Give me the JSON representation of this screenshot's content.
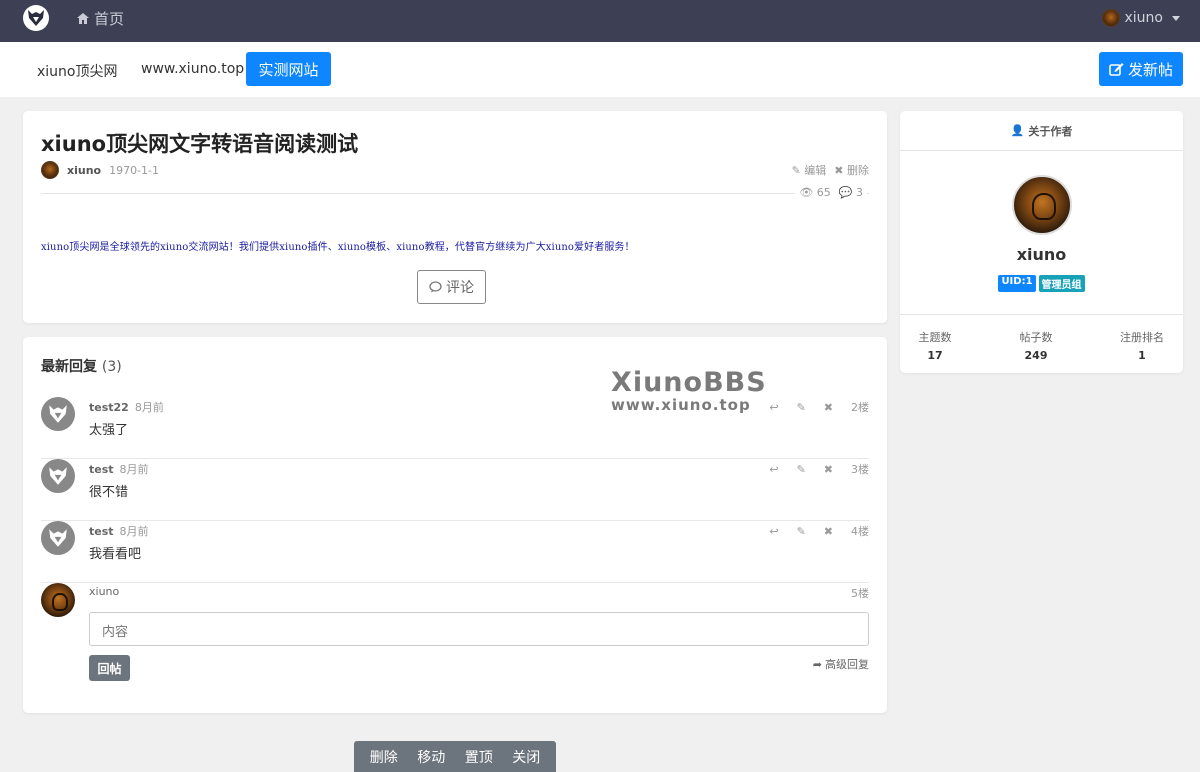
{
  "topbar": {
    "home_label": "首页",
    "user_name": "xiuno"
  },
  "subnav": {
    "links": [
      "xiuno顶尖网",
      "www.xiuno.top"
    ],
    "active_label": "实测网站",
    "new_post_label": "发新帖"
  },
  "post": {
    "title": "xiuno顶尖网文字转语音阅读测试",
    "author": "xiuno",
    "date": "1970-1-1",
    "edit_label": "编辑",
    "delete_label": "删除",
    "views": "65",
    "comments": "3",
    "body": "xiuno顶尖网是全球领先的xiuno交流网站！我们提供xiuno插件、xiuno模板、xiuno教程，代替官方继续为广大xiuno爱好者服务！",
    "comment_button": "评论"
  },
  "replies": {
    "heading": "最新回复",
    "count": "(3)",
    "items": [
      {
        "user": "test22",
        "time": "8月前",
        "text": "太强了",
        "floor": "2楼"
      },
      {
        "user": "test",
        "time": "8月前",
        "text": "很不错",
        "floor": "3楼"
      },
      {
        "user": "test",
        "time": "8月前",
        "text": "我看看吧",
        "floor": "4楼"
      }
    ],
    "composer": {
      "user": "xiuno",
      "floor": "5楼",
      "placeholder": "内容",
      "submit_label": "回帖",
      "advanced_label": "高级回复"
    }
  },
  "watermark": {
    "line1": "XiunoBBS",
    "line2": "www.xiuno.top"
  },
  "author_card": {
    "heading": "关于作者",
    "name": "xiuno",
    "uid_badge": "UID:1",
    "group_badge": "管理员组",
    "stats": [
      {
        "label": "主题数",
        "value": "17"
      },
      {
        "label": "帖子数",
        "value": "249"
      },
      {
        "label": "注册排名",
        "value": "1"
      }
    ]
  },
  "mod_toolbar": [
    "删除",
    "移动",
    "置顶",
    "关闭"
  ],
  "colors": {
    "navbar": "#3d4054",
    "primary": "#0d86ff",
    "uid_badge": "#0d86ff",
    "group_badge": "#17a2b8",
    "mod_bar": "#6c757d"
  }
}
